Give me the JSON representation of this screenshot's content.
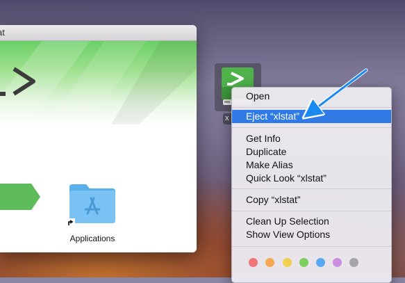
{
  "window": {
    "title": "at"
  },
  "finder": {
    "applications_label": "Applications"
  },
  "desktop": {
    "disk_label": "x"
  },
  "context_menu": {
    "items": [
      {
        "label": "Open"
      },
      {
        "label": "Eject “xlstat”"
      },
      {
        "label": "Get Info"
      },
      {
        "label": "Duplicate"
      },
      {
        "label": "Make Alias"
      },
      {
        "label": "Quick Look “xlstat”"
      },
      {
        "label": "Copy “xlstat”"
      },
      {
        "label": "Clean Up Selection"
      },
      {
        "label": "Show View Options"
      }
    ],
    "highlighted": "Eject “xlstat”",
    "tag_colors": [
      {
        "name": "red",
        "color": "#f0757a"
      },
      {
        "name": "orange",
        "color": "#f5a84f"
      },
      {
        "name": "yellow",
        "color": "#f2d04e"
      },
      {
        "name": "green",
        "color": "#7ccf5c"
      },
      {
        "name": "blue",
        "color": "#5aa8f2"
      },
      {
        "name": "purple",
        "color": "#c98ee0"
      },
      {
        "name": "gray",
        "color": "#a5a5a8"
      }
    ]
  },
  "colors": {
    "highlight": "#2f7ae5",
    "brand_green": "#5dbb5a",
    "annotation_arrow": "#1a8af0"
  }
}
